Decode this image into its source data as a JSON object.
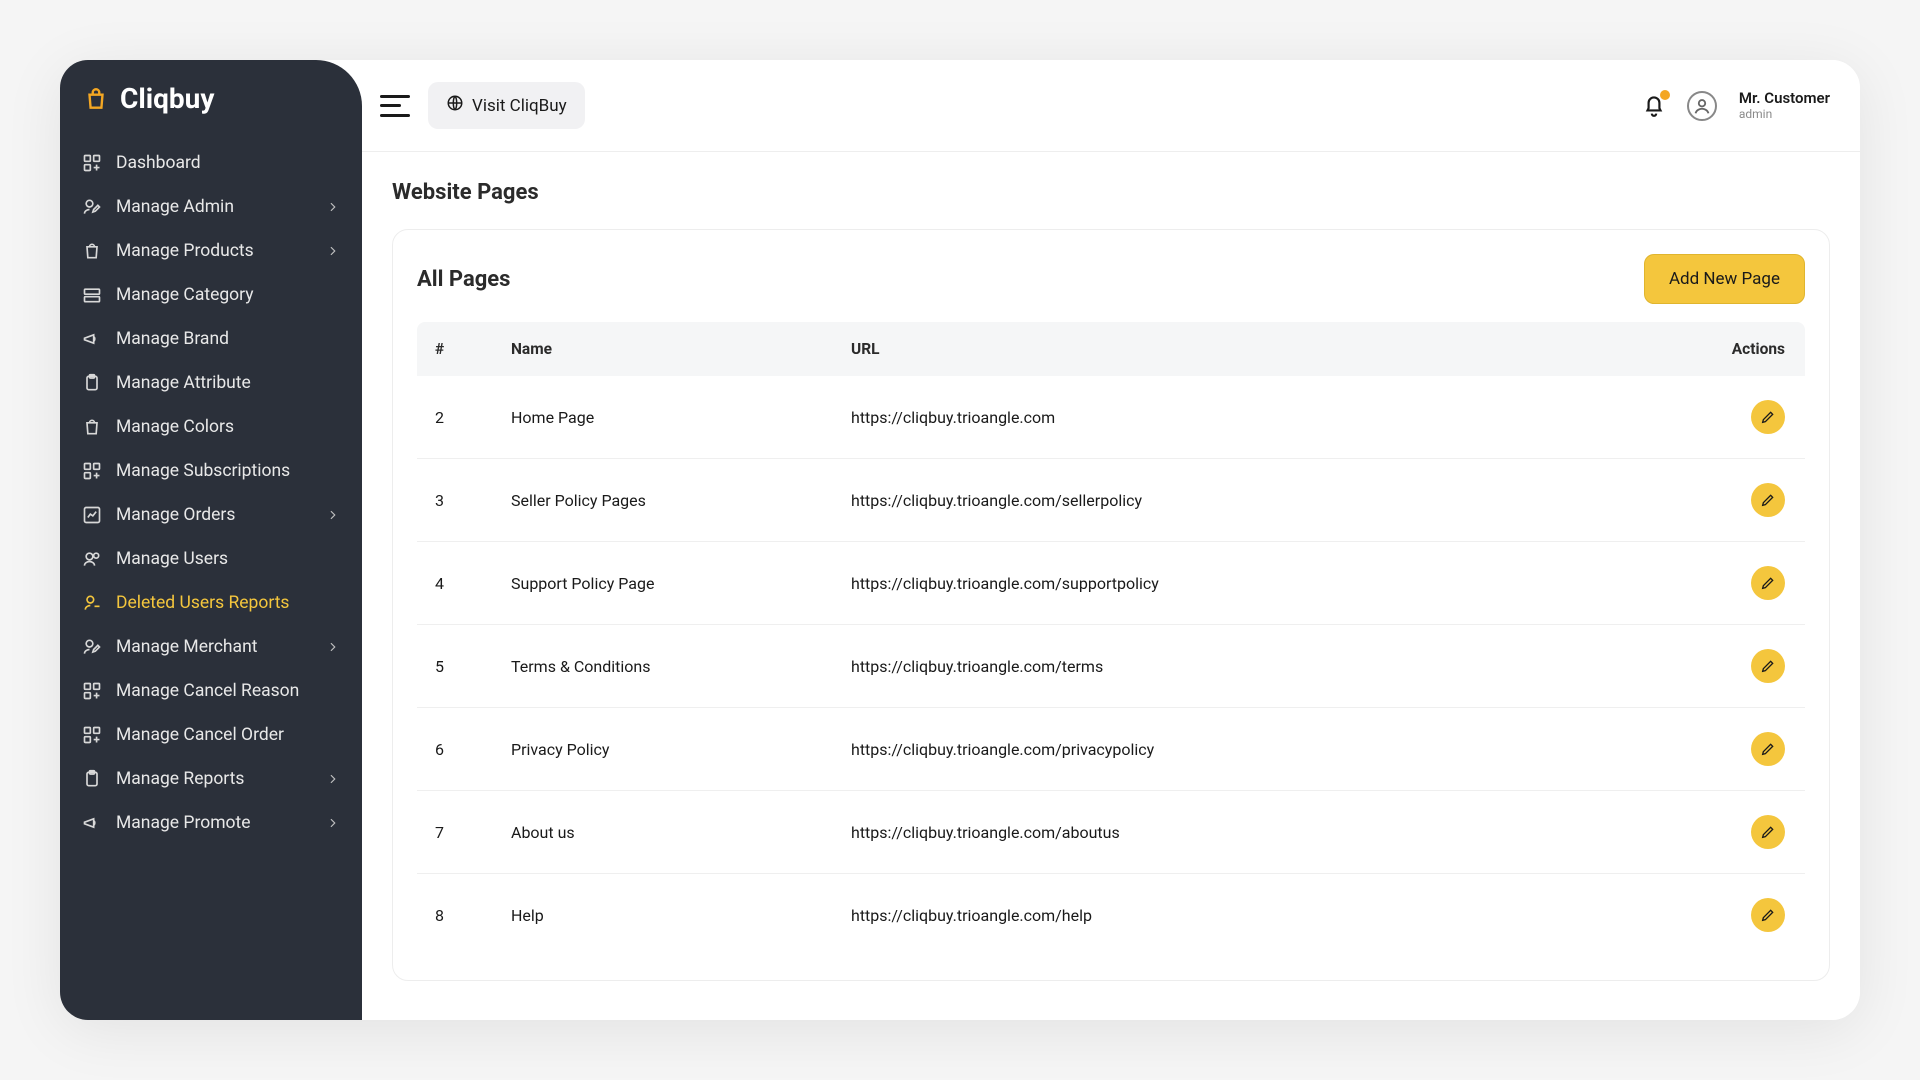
{
  "brand": {
    "name": "Cliqbuy"
  },
  "topbar": {
    "visit_label": "Visit CliqBuy",
    "user_name": "Mr. Customer",
    "user_role": "admin"
  },
  "sidebar": {
    "items": [
      {
        "label": "Dashboard",
        "icon": "grid-plus",
        "expandable": false,
        "active": false
      },
      {
        "label": "Manage Admin",
        "icon": "user-edit",
        "expandable": true,
        "active": false
      },
      {
        "label": "Manage Products",
        "icon": "bag",
        "expandable": true,
        "active": false
      },
      {
        "label": "Manage Category",
        "icon": "layers",
        "expandable": false,
        "active": false
      },
      {
        "label": "Manage Brand",
        "icon": "megaphone",
        "expandable": false,
        "active": false
      },
      {
        "label": "Manage Attribute",
        "icon": "clipboard",
        "expandable": false,
        "active": false
      },
      {
        "label": "Manage Colors",
        "icon": "bag",
        "expandable": false,
        "active": false
      },
      {
        "label": "Manage Subscriptions",
        "icon": "grid-plus",
        "expandable": false,
        "active": false
      },
      {
        "label": "Manage Orders",
        "icon": "chart",
        "expandable": true,
        "active": false
      },
      {
        "label": "Manage Users",
        "icon": "users",
        "expandable": false,
        "active": false
      },
      {
        "label": "Deleted Users Reports",
        "icon": "user-minus",
        "expandable": false,
        "active": true
      },
      {
        "label": "Manage Merchant",
        "icon": "user-edit",
        "expandable": true,
        "active": false
      },
      {
        "label": "Manage Cancel Reason",
        "icon": "grid-plus",
        "expandable": false,
        "active": false
      },
      {
        "label": "Manage Cancel Order",
        "icon": "grid-plus",
        "expandable": false,
        "active": false
      },
      {
        "label": "Manage Reports",
        "icon": "clipboard",
        "expandable": true,
        "active": false
      },
      {
        "label": "Manage Promote",
        "icon": "megaphone",
        "expandable": true,
        "active": false
      }
    ]
  },
  "page": {
    "title": "Website Pages",
    "card_title": "All Pages",
    "add_button": "Add New Page",
    "columns": {
      "col1": "#",
      "col2": "Name",
      "col3": "URL",
      "col4": "Actions"
    },
    "rows": [
      {
        "id": "2",
        "name": "Home Page",
        "url": "https://cliqbuy.trioangle.com"
      },
      {
        "id": "3",
        "name": "Seller Policy Pages",
        "url": "https://cliqbuy.trioangle.com/sellerpolicy"
      },
      {
        "id": "4",
        "name": "Support Policy Page",
        "url": "https://cliqbuy.trioangle.com/supportpolicy"
      },
      {
        "id": "5",
        "name": "Terms & Conditions",
        "url": "https://cliqbuy.trioangle.com/terms"
      },
      {
        "id": "6",
        "name": "Privacy Policy",
        "url": "https://cliqbuy.trioangle.com/privacypolicy"
      },
      {
        "id": "7",
        "name": "About us",
        "url": "https://cliqbuy.trioangle.com/aboutus"
      },
      {
        "id": "8",
        "name": "Help",
        "url": "https://cliqbuy.trioangle.com/help"
      }
    ]
  }
}
